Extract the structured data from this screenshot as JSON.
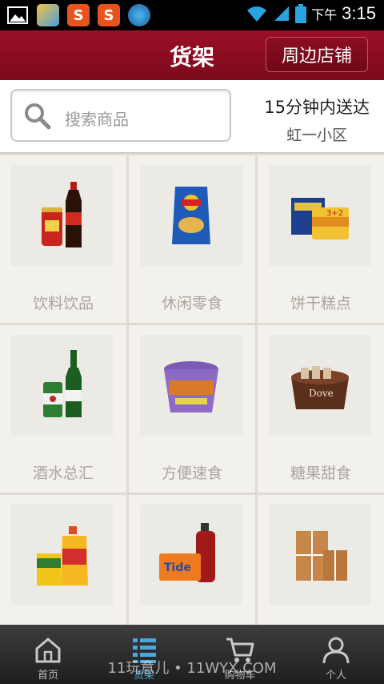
{
  "status_bar": {
    "ampm": "下午",
    "time": "3:15"
  },
  "header": {
    "title": "货架",
    "store_button": "周边店铺"
  },
  "search": {
    "placeholder": "搜索商品"
  },
  "delivery": {
    "time_text": "15分钟内送达",
    "area": "虹一小区"
  },
  "categories": [
    {
      "label": "饮料饮品",
      "icon": "drinks-image"
    },
    {
      "label": "休闲零食",
      "icon": "chips-image"
    },
    {
      "label": "饼干糕点",
      "icon": "biscuits-image"
    },
    {
      "label": "酒水总汇",
      "icon": "beer-image"
    },
    {
      "label": "方便速食",
      "icon": "instant-noodles-image"
    },
    {
      "label": "糖果甜食",
      "icon": "chocolate-image"
    },
    {
      "label": "",
      "icon": "cooking-oil-image"
    },
    {
      "label": "",
      "icon": "detergent-image"
    },
    {
      "label": "",
      "icon": "package-boxes-image"
    }
  ],
  "nav": {
    "items": [
      {
        "label": "首页",
        "icon": "home-icon"
      },
      {
        "label": "货架",
        "icon": "list-icon"
      },
      {
        "label": "购物车",
        "icon": "cart-icon"
      },
      {
        "label": "个人",
        "icon": "person-icon"
      }
    ],
    "active_index": 1
  },
  "watermark": "11玩意儿 • 11WYX.COM",
  "colors": {
    "header": "#8c0d22",
    "active_nav": "#4da5de",
    "category_text": "#a9a6a0"
  }
}
